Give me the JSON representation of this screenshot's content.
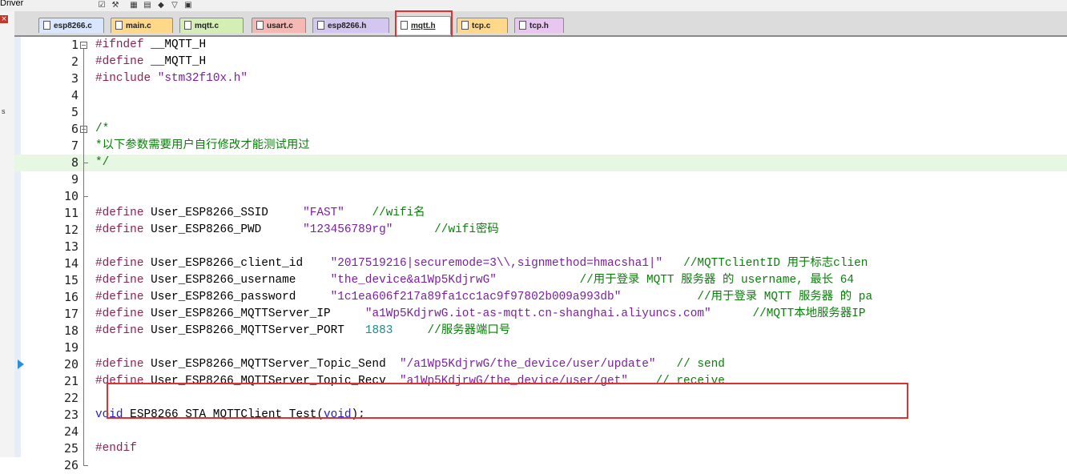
{
  "toolbar": {
    "driver_label": "Driver"
  },
  "tabs": [
    {
      "label": "esp8266.c",
      "color": "#d9e6ff"
    },
    {
      "label": "main.c",
      "color": "#ffd88a"
    },
    {
      "label": "mqtt.c",
      "color": "#d4efb4"
    },
    {
      "label": "usart.c",
      "color": "#f6b8b3"
    },
    {
      "label": "esp8266.h",
      "color": "#d3c6f1"
    },
    {
      "label": "mqtt.h",
      "color": "#ffffff",
      "active": true
    },
    {
      "label": "tcp.c",
      "color": "#ffd88a"
    },
    {
      "label": "tcp.h",
      "color": "#e9c6f1"
    }
  ],
  "editor": {
    "current_line": 8,
    "lines": [
      {
        "n": "1",
        "code": "#ifndef __MQTT_H"
      },
      {
        "n": "2",
        "code": "#define __MQTT_H"
      },
      {
        "n": "3",
        "code": "#include \"stm32f10x.h\""
      },
      {
        "n": "4",
        "code": ""
      },
      {
        "n": "5",
        "code": ""
      },
      {
        "n": "6",
        "code": "/*"
      },
      {
        "n": "7",
        "code": "*以下参数需要用户自行修改才能测试用过"
      },
      {
        "n": "8",
        "code": "*/"
      },
      {
        "n": "9",
        "code": ""
      },
      {
        "n": "10",
        "code": ""
      },
      {
        "n": "11",
        "code": "#define User_ESP8266_SSID     \"FAST\"    //wifi名"
      },
      {
        "n": "12",
        "code": "#define User_ESP8266_PWD      \"123456789rg\"      //wifi密码"
      },
      {
        "n": "13",
        "code": ""
      },
      {
        "n": "14",
        "code": "#define User_ESP8266_client_id    \"2017519216|securemode=3\\\\,signmethod=hmacsha1|\"   //MQTTclientID 用于标志clien"
      },
      {
        "n": "15",
        "code": "#define User_ESP8266_username     \"the_device&a1Wp5KdjrwG\"            //用于登录 MQTT 服务器 的 username, 最长 64"
      },
      {
        "n": "16",
        "code": "#define User_ESP8266_password     \"1c1ea606f217a89fa1cc1ac9f97802b009a993db\"           //用于登录 MQTT 服务器 的 pa"
      },
      {
        "n": "17",
        "code": "#define User_ESP8266_MQTTServer_IP     \"a1Wp5KdjrwG.iot-as-mqtt.cn-shanghai.aliyuncs.com\"      //MQTT本地服务器IP"
      },
      {
        "n": "18",
        "code": "#define User_ESP8266_MQTTServer_PORT   1883     //服务器端口号"
      },
      {
        "n": "19",
        "code": ""
      },
      {
        "n": "20",
        "code": "#define User_ESP8266_MQTTServer_Topic_Send  \"/a1Wp5KdjrwG/the_device/user/update\"   // send"
      },
      {
        "n": "21",
        "code": "#define User_ESP8266_MQTTServer_Topic_Recv  \"a1Wp5KdjrwG/the_device/user/get\"    // receive"
      },
      {
        "n": "22",
        "code": ""
      },
      {
        "n": "23",
        "code": "void ESP8266_STA_MQTTClient_Test(void);"
      },
      {
        "n": "24",
        "code": ""
      },
      {
        "n": "25",
        "code": "#endif"
      },
      {
        "n": "26",
        "code": ""
      }
    ]
  }
}
